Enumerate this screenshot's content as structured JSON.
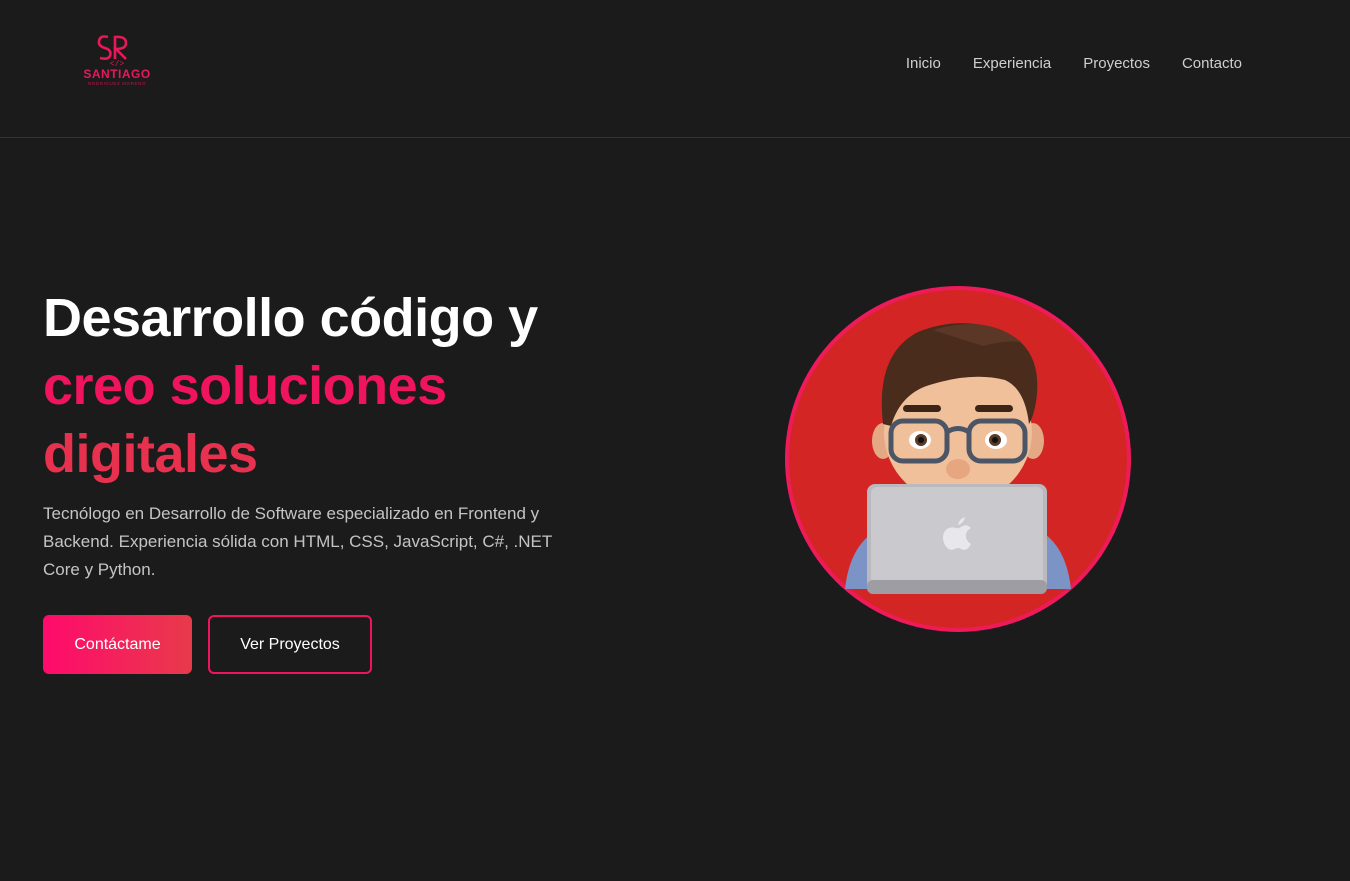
{
  "brand": {
    "monogram": "SR",
    "code_symbol": "</>",
    "name": "SANTIAGO",
    "subtitle": "RODRIGUEZ MORENO"
  },
  "nav": {
    "items": [
      {
        "label": "Inicio"
      },
      {
        "label": "Experiencia"
      },
      {
        "label": "Proyectos"
      },
      {
        "label": "Contacto"
      }
    ]
  },
  "hero": {
    "title_line1": "Desarrollo código y",
    "title_line2": "creo soluciones",
    "title_line3": "digitales",
    "description": "Tecnólogo en Desarrollo de Software especializado en Frontend y Backend. Experiencia sólida con HTML, CSS, JavaScript, C#, .NET Core y Python.",
    "primary_button": "Contáctame",
    "secondary_button": "Ver Proyectos"
  },
  "avatar": {
    "icon": "memoji-avatar-with-laptop"
  },
  "colors": {
    "background": "#1b1b1c",
    "accent": "#f0145e",
    "avatar_bg": "#d42525",
    "nav_text": "#cfcfcf"
  }
}
